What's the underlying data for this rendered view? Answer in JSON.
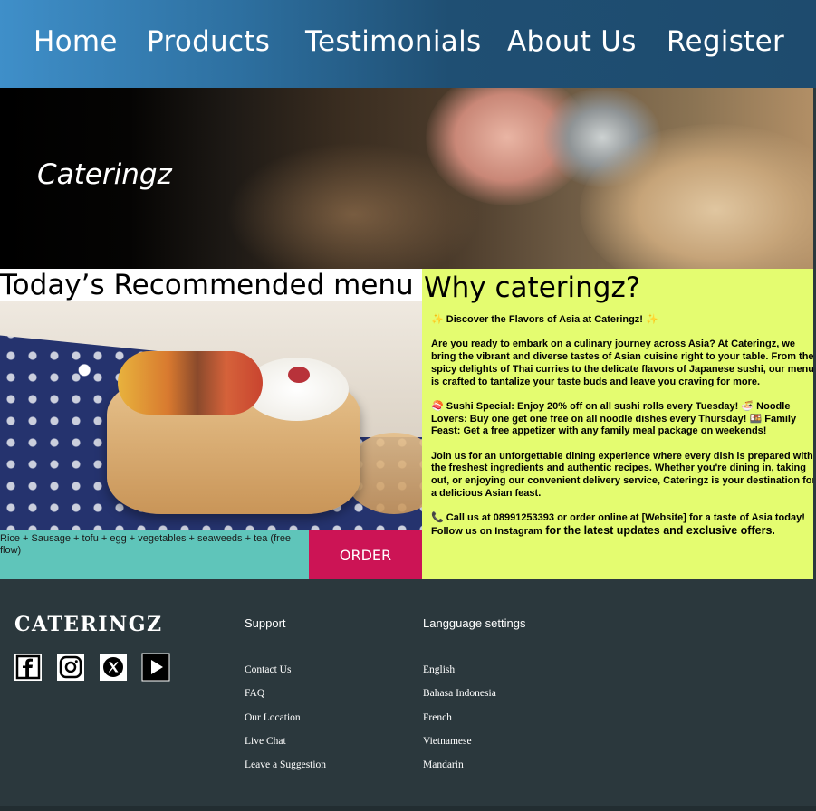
{
  "nav": {
    "items": [
      {
        "label": "Home"
      },
      {
        "label": "Products"
      },
      {
        "label": "Testimonials"
      },
      {
        "label": "About Us"
      },
      {
        "label": "Register"
      }
    ]
  },
  "hero": {
    "title": "Cateringz"
  },
  "recommended": {
    "title": "Today’s Recommended menu",
    "description": "Rice + Sausage + tofu + egg + vegetables + seaweeds + tea (free flow)",
    "order_label": "ORDER"
  },
  "why": {
    "title": "Why cateringz?",
    "p1": "Discover the Flavors of Asia at Cateringz!",
    "p2": "Are you ready to embark on a culinary journey across Asia? At Cateringz, we bring the vibrant and diverse tastes of Asian cuisine right to your table. From the spicy delights of Thai curries to the delicate flavors of Japanese sushi, our menu is crafted to tantalize your taste buds and leave you craving for more.",
    "p3a": "Sushi Special: Enjoy 20% off on all sushi rolls every Tuesday!",
    "p3b": "Noodle Lovers: Buy one get one free on all noodle dishes every Thursday!",
    "p3c": "Family Feast: Get a free appetizer with any family meal package on weekends!",
    "p4": "Join us for an unforgettable dining experience where every dish is prepared with the freshest ingredients and authentic recipes. Whether you're dining in, taking out, or enjoying our convenient delivery service, Cateringz is your destination for a delicious Asian feast.",
    "p5": "Call us at 08991253393 or order online at [Website] for a taste of Asia today!",
    "p6a": "Follow us on Instagram",
    "p6b": " for the latest updates and exclusive offers."
  },
  "footer": {
    "brand": "CATERINGZ",
    "social_icons": [
      "facebook-icon",
      "instagram-icon",
      "x-icon",
      "youtube-icon"
    ],
    "support": {
      "heading": "Support",
      "links": [
        "Contact Us",
        "FAQ",
        "Our Location",
        "Live Chat",
        "Leave a Suggestion"
      ]
    },
    "language": {
      "heading": "Langguage settings",
      "links": [
        "English",
        "Bahasa Indonesia",
        "French",
        "Vietnamese",
        "Mandarin"
      ]
    }
  },
  "colors": {
    "order_button": "#cc1455",
    "why_background": "#e4fc70",
    "menu_bar": "#5fc5ba",
    "footer": "#2b383d"
  }
}
